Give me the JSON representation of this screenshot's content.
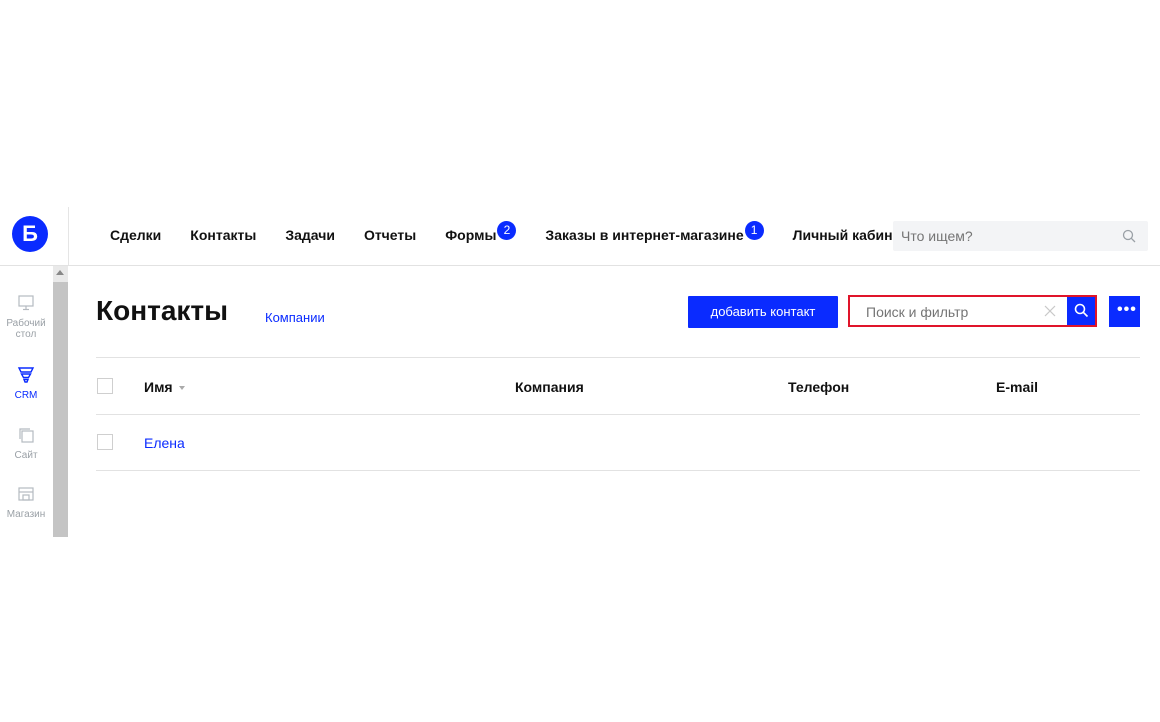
{
  "topbar": {
    "logo": "Б",
    "nav": [
      {
        "label": "Сделки",
        "badge": null
      },
      {
        "label": "Контакты",
        "badge": null
      },
      {
        "label": "Задачи",
        "badge": null
      },
      {
        "label": "Отчеты",
        "badge": null
      },
      {
        "label": "Формы",
        "badge": "2"
      },
      {
        "label": "Заказы в интернет-магазине",
        "badge": "1"
      },
      {
        "label": "Личный кабинет",
        "badge": null
      }
    ],
    "search_placeholder": "Что ищем?"
  },
  "sidebar": {
    "items": [
      {
        "label": "Рабочий стол",
        "icon": "desktop-icon",
        "active": false
      },
      {
        "label": "CRM",
        "icon": "funnel-icon",
        "active": true
      },
      {
        "label": "Сайт",
        "icon": "site-icon",
        "active": false
      },
      {
        "label": "Магазин",
        "icon": "store-icon",
        "active": false
      }
    ]
  },
  "page": {
    "title": "Контакты",
    "companies_link": "Компании",
    "add_button": "добавить контакт",
    "filter_placeholder": "Поиск и фильтр"
  },
  "table": {
    "columns": [
      "Имя",
      "Компания",
      "Телефон",
      "E-mail"
    ],
    "rows": [
      {
        "name": "Елена",
        "company": "",
        "phone": "",
        "email": ""
      }
    ]
  },
  "colors": {
    "accent": "#0a2bff",
    "highlight_border": "#e0142a"
  }
}
